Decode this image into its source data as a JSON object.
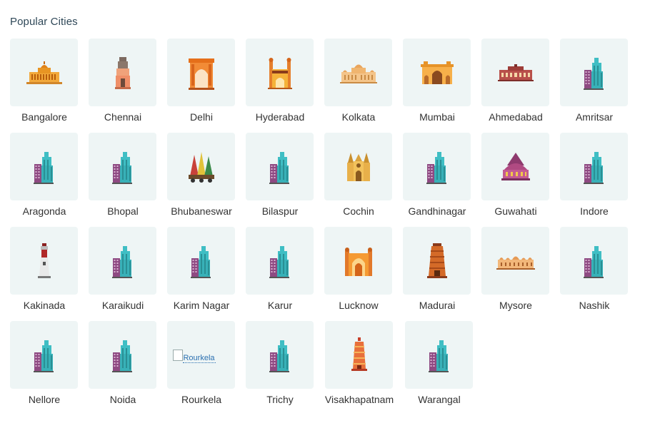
{
  "section": {
    "title": "Popular Cities"
  },
  "colors": {
    "tile_bg": "#eef5f5",
    "title_text": "#2f4858",
    "label_text": "#333333"
  },
  "cities": [
    {
      "name": "Bangalore",
      "icon": "vidhana-soudha-icon"
    },
    {
      "name": "Chennai",
      "icon": "chennai-temple-icon"
    },
    {
      "name": "Delhi",
      "icon": "india-gate-icon"
    },
    {
      "name": "Hyderabad",
      "icon": "charminar-icon"
    },
    {
      "name": "Kolkata",
      "icon": "victoria-memorial-icon"
    },
    {
      "name": "Mumbai",
      "icon": "gateway-of-india-icon"
    },
    {
      "name": "Ahmedabad",
      "icon": "ahmedabad-monument-icon"
    },
    {
      "name": "Amritsar",
      "icon": "generic-building-icon"
    },
    {
      "name": "Aragonda",
      "icon": "generic-building-icon"
    },
    {
      "name": "Bhopal",
      "icon": "generic-building-icon"
    },
    {
      "name": "Bhubaneswar",
      "icon": "jagannath-temple-icon"
    },
    {
      "name": "Bilaspur",
      "icon": "generic-building-icon"
    },
    {
      "name": "Cochin",
      "icon": "cochin-church-icon"
    },
    {
      "name": "Gandhinagar",
      "icon": "generic-building-icon"
    },
    {
      "name": "Guwahati",
      "icon": "kamakhya-temple-icon"
    },
    {
      "name": "Indore",
      "icon": "generic-building-icon"
    },
    {
      "name": "Kakinada",
      "icon": "lighthouse-icon"
    },
    {
      "name": "Karaikudi",
      "icon": "generic-building-icon"
    },
    {
      "name": "Karim Nagar",
      "icon": "generic-building-icon"
    },
    {
      "name": "Karur",
      "icon": "generic-building-icon"
    },
    {
      "name": "Lucknow",
      "icon": "lucknow-gate-icon"
    },
    {
      "name": "Madurai",
      "icon": "gopuram-icon"
    },
    {
      "name": "Mysore",
      "icon": "mysore-palace-icon"
    },
    {
      "name": "Nashik",
      "icon": "generic-building-icon"
    },
    {
      "name": "Nellore",
      "icon": "generic-building-icon"
    },
    {
      "name": "Noida",
      "icon": "generic-building-icon"
    },
    {
      "name": "Rourkela",
      "icon": "broken-image-icon",
      "alt": "Rourkela"
    },
    {
      "name": "Trichy",
      "icon": "generic-building-icon"
    },
    {
      "name": "Visakhapatnam",
      "icon": "vizag-temple-icon"
    },
    {
      "name": "Warangal",
      "icon": "generic-building-icon"
    }
  ]
}
